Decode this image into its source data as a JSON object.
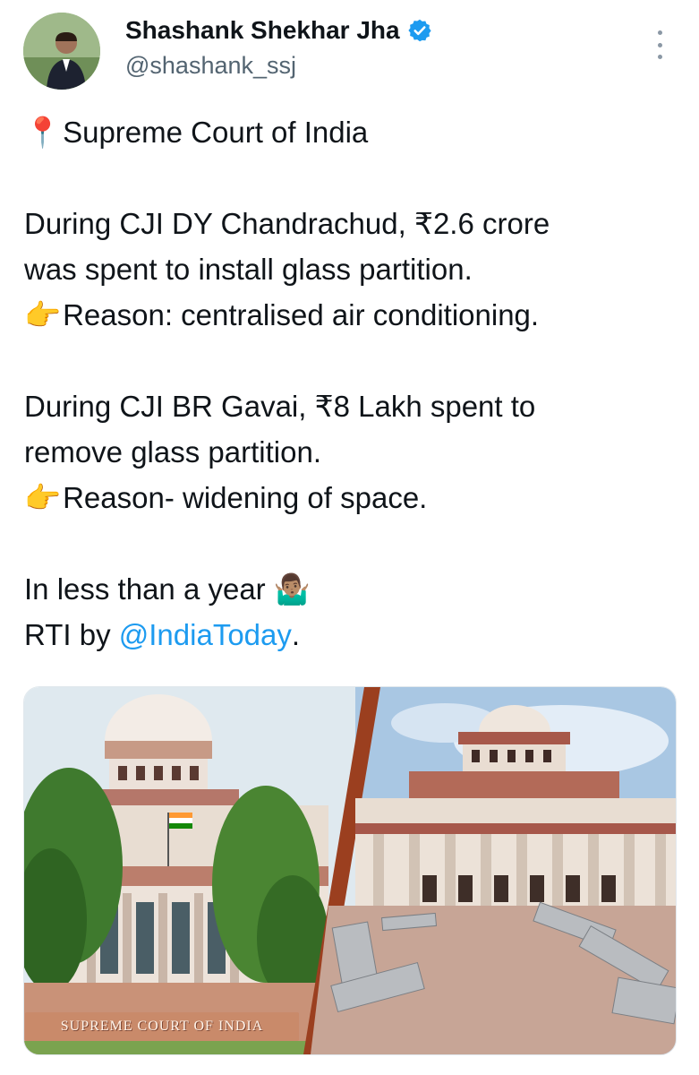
{
  "author": {
    "display_name": "Shashank Shekhar Jha",
    "handle": "@shashank_ssj",
    "verified_icon": "verified-badge-icon",
    "verified_color": "#1d9bf0"
  },
  "menu": {
    "icon": "more-vertical-icon"
  },
  "tweet": {
    "line1_emoji": "📍",
    "line1": "Supreme Court of India",
    "line2": "During CJI DY Chandrachud, ₹2.6 crore",
    "line3": "was spent to install glass partition.",
    "line4_emoji": "👉",
    "line4": "Reason: centralised air conditioning.",
    "line5": "During CJI BR Gavai, ₹8 Lakh spent to",
    "line6": "remove glass partition.",
    "line7_emoji": "👉",
    "line7": "Reason- widening of space.",
    "line8": "In less than a year",
    "line8_emoji": "🤷🏽‍♂️",
    "line9_prefix": "RTI by ",
    "line9_mention": "@IndiaToday",
    "line9_suffix": ".",
    "mention_color": "#1d9bf0"
  },
  "media": {
    "plate_text": "SUPREME COURT OF INDIA"
  }
}
